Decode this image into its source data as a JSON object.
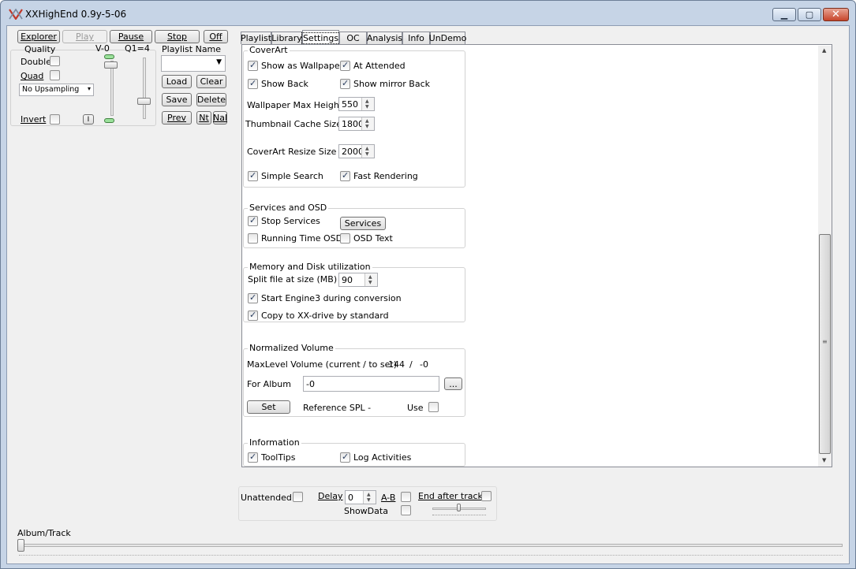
{
  "window": {
    "title": "XXHighEnd 0.9y-5-06"
  },
  "toolbar": {
    "explorer": "Explorer",
    "play": "Play",
    "pause": "Pause",
    "stop": "Stop",
    "off": "Off"
  },
  "quality": {
    "title": "Quality",
    "double": "Double",
    "quad": "Quad",
    "upsampling": "No Upsampling",
    "invert": "Invert",
    "i_button": "I",
    "v_label": "V-0",
    "q_label": "Q1=4"
  },
  "playlist": {
    "title": "Playlist Name",
    "load": "Load",
    "clear": "Clear",
    "save": "Save",
    "delete": "Delete",
    "prev": "Prev",
    "nt": "Nt",
    "nal": "Nal"
  },
  "tabs": [
    "Playlist",
    "Library",
    "Settings",
    "OC",
    "Analysis",
    "Info",
    "UnDemo"
  ],
  "coverart": {
    "title": "CoverArt",
    "show_wallpaper": "Show as Wallpaper",
    "at_attended": "At Attended",
    "show_back": "Show Back",
    "show_mirror_back": "Show mirror Back",
    "wallpaper_max_height_label": "Wallpaper Max Height",
    "wallpaper_max_height": "550",
    "thumbnail_cache_label": "Thumbnail Cache Size",
    "thumbnail_cache": "1800",
    "resize_label": "CoverArt Resize Size",
    "resize": "2000",
    "simple_search": "Simple Search",
    "fast_rendering": "Fast Rendering"
  },
  "services": {
    "title": "Services and OSD",
    "stop_services": "Stop Services",
    "services_button": "Services",
    "running_time_osd": "Running Time OSD",
    "osd_text": "OSD Text"
  },
  "memory": {
    "title": "Memory and Disk utilization",
    "split_label": "Split file at size (MB)",
    "split": "90",
    "start_engine": "Start Engine3 during conversion",
    "copy_xx": "Copy to XX-drive by standard"
  },
  "normvol": {
    "title": "Normalized Volume",
    "maxlevel_label": "MaxLevel Volume (current / to set)",
    "current": "-144",
    "slash": "/",
    "to_set": "-0",
    "for_album_label": "For Album",
    "for_album": "-0",
    "browse": "...",
    "set": "Set",
    "reference_spl": "Reference SPL  -",
    "use": "Use"
  },
  "information": {
    "title": "Information",
    "tooltips": "ToolTips",
    "log_activities": "Log Activities"
  },
  "bottom": {
    "unattended": "Unattended",
    "delay": "Delay",
    "delay_value": "0",
    "ab": "A-B",
    "end_after_track": "End after track",
    "showdata": "ShowData"
  },
  "album_track": {
    "label": "Album/Track"
  }
}
